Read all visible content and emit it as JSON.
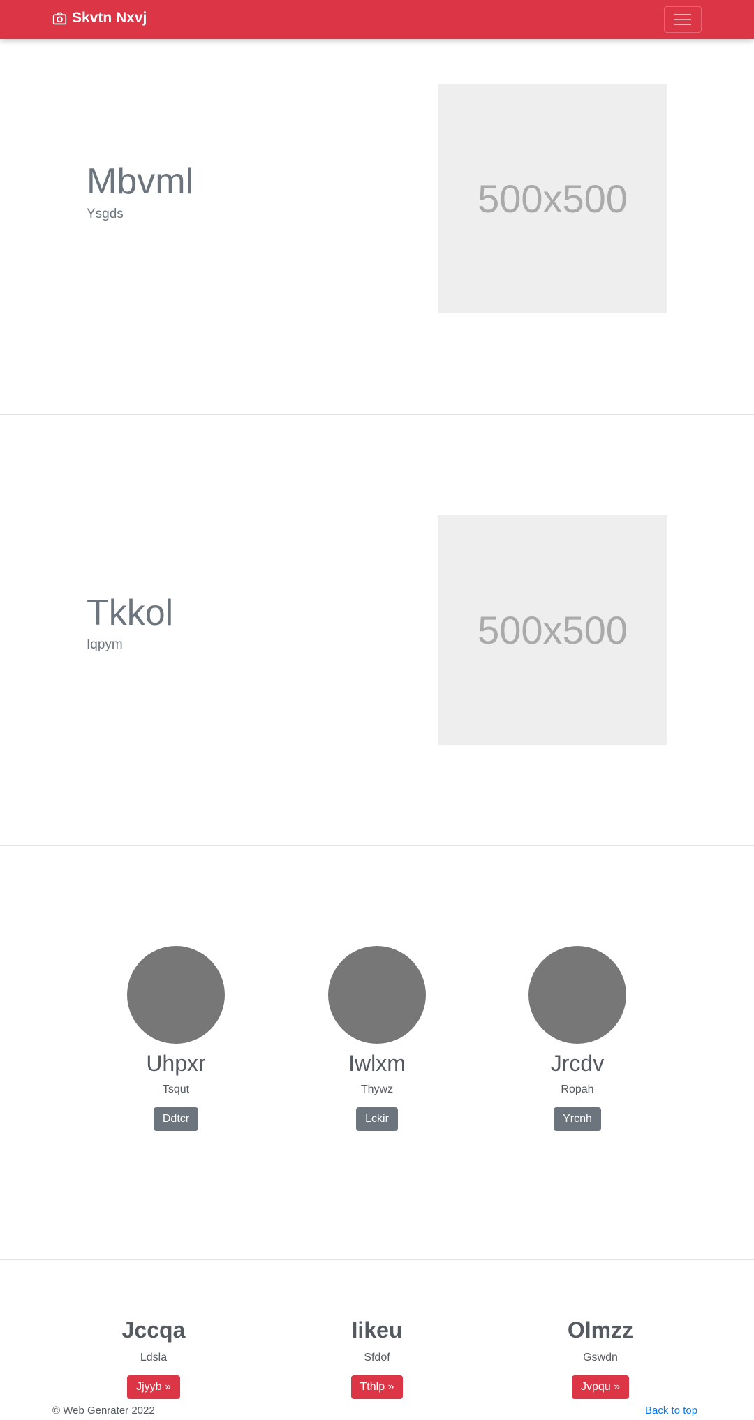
{
  "navbar": {
    "brand": "Skvtn Nxvj",
    "brand_icon": "camera-icon",
    "toggler_icon": "hamburger-icon",
    "color": "#dc3545"
  },
  "features": [
    {
      "title": "Mbvml",
      "lead": "Ysgds",
      "image_label": "500x500"
    },
    {
      "title": "Tkkol",
      "lead": "Iqpym",
      "image_label": "500x500"
    }
  ],
  "team": [
    {
      "name": "Uhpxr",
      "role": "Tsqut",
      "button": "Ddtcr"
    },
    {
      "name": "Iwlxm",
      "role": "Thywz",
      "button": "Lckir"
    },
    {
      "name": "Jrcdv",
      "role": "Ropah",
      "button": "Yrcnh"
    }
  ],
  "trio": [
    {
      "title": "Jccqa",
      "text": "Ldsla",
      "button": "Jjyyb »"
    },
    {
      "title": "Iikeu",
      "text": "Sfdof",
      "button": "Tthlp »"
    },
    {
      "title": "Olmzz",
      "text": "Gswdn",
      "button": "Jvpqu »"
    }
  ],
  "footer": {
    "copyright": "© Web Genrater 2022",
    "back_to_top": "Back to top"
  }
}
